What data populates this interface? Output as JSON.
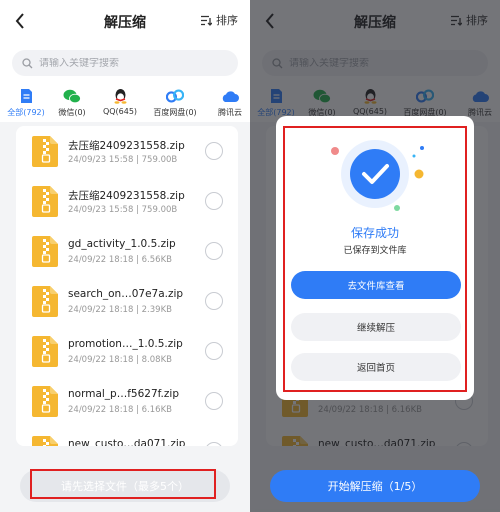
{
  "header": {
    "title": "解压缩",
    "sort_label": "排序"
  },
  "search": {
    "placeholder": "请输入关键字搜索"
  },
  "tabs": [
    {
      "label": "全部(792)",
      "icon": "file-icon",
      "color": "#2f7cf6"
    },
    {
      "label": "微信(0)",
      "icon": "wechat-icon",
      "color": "#22b14c"
    },
    {
      "label": "QQ(645)",
      "icon": "qq-icon",
      "color": "#222222"
    },
    {
      "label": "百度网盘(0)",
      "icon": "baidu-netdisk-icon",
      "color": "#2f7cf6"
    },
    {
      "label": "腾讯云",
      "icon": "tencent-cloud-icon",
      "color": "#2f7cf6"
    }
  ],
  "files": [
    {
      "name": "去压缩2409231558.zip",
      "meta": "24/09/23 15:58 | 759.00B"
    },
    {
      "name": "去压缩2409231558.zip",
      "meta": "24/09/23 15:58 | 759.00B"
    },
    {
      "name": "gd_activity_1.0.5.zip",
      "meta": "24/09/22 18:18 | 6.56KB"
    },
    {
      "name": "search_on…07e7a.zip",
      "meta": "24/09/22 18:18 | 2.39KB"
    },
    {
      "name": "promotion…_1.0.5.zip",
      "meta": "24/09/22 18:18 | 8.08KB"
    },
    {
      "name": "normal_p…f5627f.zip",
      "meta": "24/09/22 18:18 | 6.16KB"
    },
    {
      "name": "new_custo…da071.zip",
      "meta": ""
    }
  ],
  "bottom": {
    "select_label": "请先选择文件（最多5个）",
    "start_label": "开始解压缩（1/5）"
  },
  "modal": {
    "title": "保存成功",
    "subtitle": "已保存到文件库",
    "primary_label": "去文件库查看",
    "continue_label": "继续解压",
    "home_label": "返回首页"
  },
  "colors": {
    "accent": "#2f7cf6",
    "zip": "#f5b731",
    "highlight": "#e02020"
  }
}
